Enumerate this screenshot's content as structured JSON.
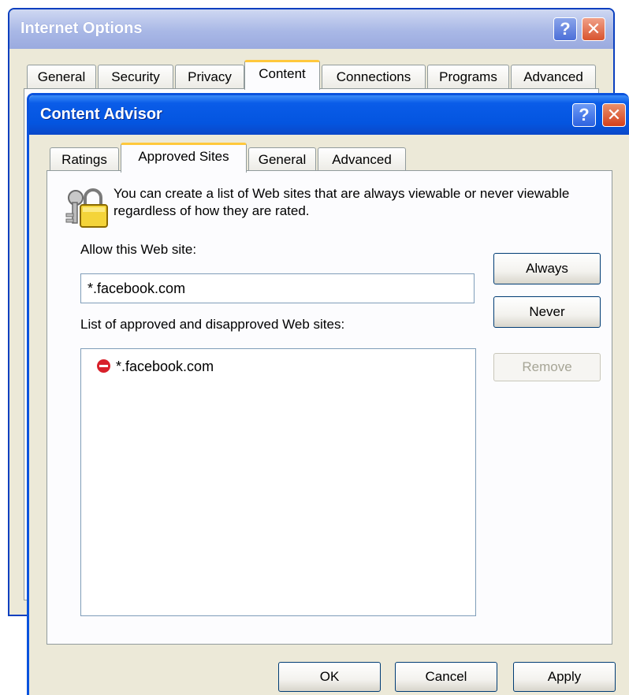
{
  "back_window": {
    "title": "Internet Options",
    "help_label": "?",
    "close_label": "✕",
    "tabs": [
      {
        "label": "General"
      },
      {
        "label": "Security"
      },
      {
        "label": "Privacy"
      },
      {
        "label": "Content",
        "active": true
      },
      {
        "label": "Connections"
      },
      {
        "label": "Programs"
      },
      {
        "label": "Advanced"
      }
    ]
  },
  "dialog": {
    "title": "Content Advisor",
    "help_label": "?",
    "close_label": "✕",
    "tabs": [
      {
        "label": "Ratings"
      },
      {
        "label": "Approved Sites",
        "active": true
      },
      {
        "label": "General"
      },
      {
        "label": "Advanced"
      }
    ],
    "description": "You can create a list of Web sites that are always viewable or never viewable regardless of how they are rated.",
    "allow_label": "Allow this Web site:",
    "allow_value": "*.facebook.com",
    "list_label": "List of approved and disapproved Web sites:",
    "sites": [
      {
        "name": "*.facebook.com",
        "status": "never",
        "icon": "block-icon"
      }
    ],
    "buttons": {
      "always": "Always",
      "never": "Never",
      "remove": "Remove",
      "ok": "OK",
      "cancel": "Cancel",
      "apply": "Apply"
    }
  },
  "colors": {
    "titlebar_active": "#0a5ce8",
    "titlebar_inactive": "#a9b8e6",
    "dialog_bg": "#ece9d8",
    "block_icon": "#d8202a",
    "tab_highlight": "#ffc83c"
  }
}
